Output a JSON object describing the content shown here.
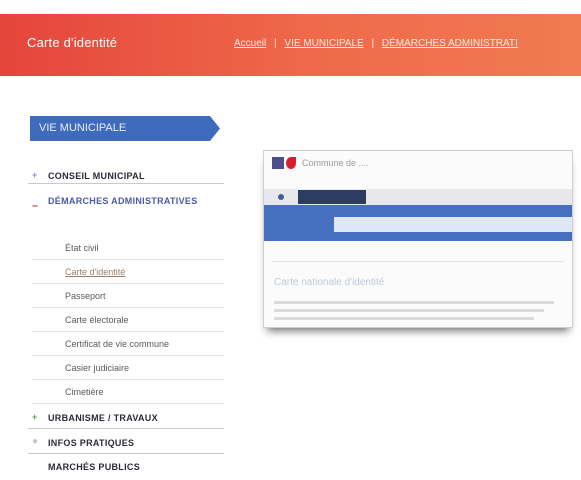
{
  "header": {
    "title": "Carte d'identité",
    "breadcrumb": [
      "Accueil",
      "VIE MUNICIPALE",
      "DÉMARCHES ADMINISTRATI"
    ],
    "separator": "|"
  },
  "sidebar": {
    "title": "VIE MUNICIPALE",
    "items": [
      {
        "label": "CONSEIL MUNICIPAL",
        "marker": "+"
      },
      {
        "label": "DÉMARCHES ADMINISTRATIVES",
        "marker": "–",
        "children": [
          {
            "label": "État civil"
          },
          {
            "label": "Carte d'identité",
            "active": true
          },
          {
            "label": "Passeport"
          },
          {
            "label": "Carte électorale"
          },
          {
            "label": "Certificat de vie commune"
          },
          {
            "label": "Casier judiciaire"
          },
          {
            "label": "Cimetière"
          }
        ]
      },
      {
        "label": "URBANISME / TRAVAUX",
        "marker": "+"
      },
      {
        "label": "INFOS PRATIQUES",
        "marker": "●"
      },
      {
        "label": "MARCHÉS PUBLICS"
      }
    ]
  },
  "content": {
    "thumbnail": {
      "site_title": "Commune de ....",
      "heading": "Carte nationale d'identité"
    }
  }
}
